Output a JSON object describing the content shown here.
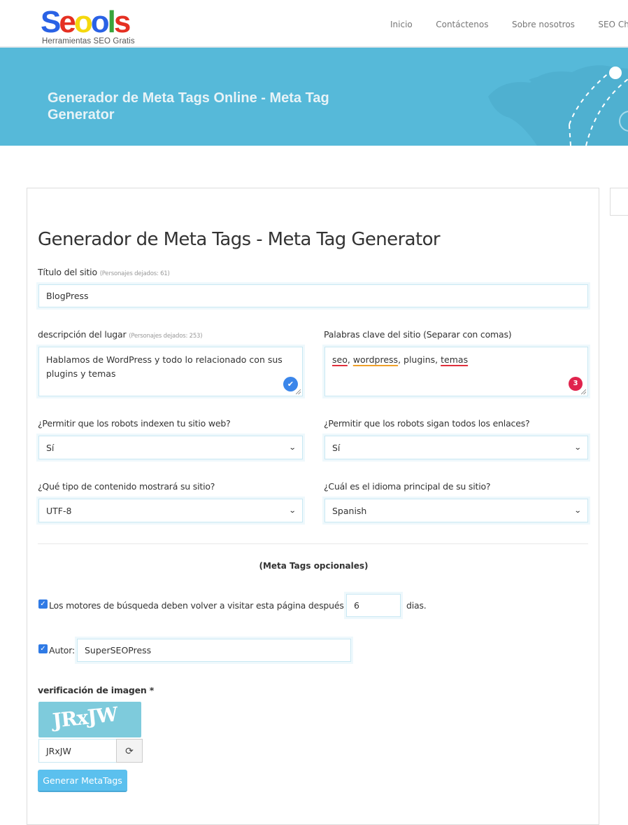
{
  "logo": {
    "letters": [
      {
        "char": "S",
        "color": "#2a62e5"
      },
      {
        "char": "e",
        "color": "#e53022"
      },
      {
        "char": "o",
        "color": "#f5d80d"
      },
      {
        "char": "o",
        "color": "#2a62e5"
      },
      {
        "char": "l",
        "color": "#3aa43b"
      },
      {
        "char": "s",
        "color": "#e53022"
      }
    ],
    "tagline": "Herramientas SEO Gratis"
  },
  "nav": {
    "items": [
      "Inicio",
      "Contáctenos",
      "Sobre nosotros",
      "SEO Che"
    ]
  },
  "banner": {
    "title": "Generador de Meta Tags Online - Meta Tag Generator"
  },
  "form": {
    "heading": "Generador de Meta Tags - Meta Tag Generator",
    "site_title": {
      "label": "Título del sitio",
      "hint": "(Personajes dejados: 61)",
      "value": "BlogPress"
    },
    "description": {
      "label": "descripción del lugar",
      "hint": "(Personajes dejados: 253)",
      "value": "Hablamos de WordPress y todo lo relacionado con sus plugins y temas",
      "badge_icon": "check-icon"
    },
    "keywords": {
      "label": "Palabras clave del sitio (Separar con comas)",
      "words": [
        {
          "text": "seo",
          "spell": "red"
        },
        {
          "text": ", ",
          "spell": ""
        },
        {
          "text": "wordpress",
          "spell": "orange"
        },
        {
          "text": ", plugins, ",
          "spell": ""
        },
        {
          "text": "temas",
          "spell": "red"
        }
      ],
      "issue_count": "3"
    },
    "robots_index": {
      "label": "¿Permitir que los robots indexen tu sitio web?",
      "value": "Sí"
    },
    "robots_follow": {
      "label": "¿Permitir que los robots sigan todos los enlaces?",
      "value": "Sí"
    },
    "content_type": {
      "label": "¿Qué tipo de contenido mostrará su sitio?",
      "value": "UTF-8"
    },
    "language": {
      "label": "¿Cuál es el idioma principal de su sitio?",
      "value": "Spanish"
    },
    "optional_heading": "(Meta Tags opcionales)",
    "revisit": {
      "checked": true,
      "label": "Los motores de búsqueda deben volver a visitar esta página después de",
      "value": "6",
      "suffix": "dias."
    },
    "author": {
      "checked": true,
      "label": "Autor:",
      "value": "SuperSEOPress"
    },
    "captcha": {
      "label": "verificación de imagen *",
      "image_text": "JRxJW",
      "value": "JRxJW",
      "refresh_icon": "refresh-icon"
    },
    "submit_label": "Generar MetaTags"
  },
  "colors": {
    "banner": "#56b9d9",
    "button": "#5bc0ee",
    "checkbox": "#2f7ae5"
  }
}
